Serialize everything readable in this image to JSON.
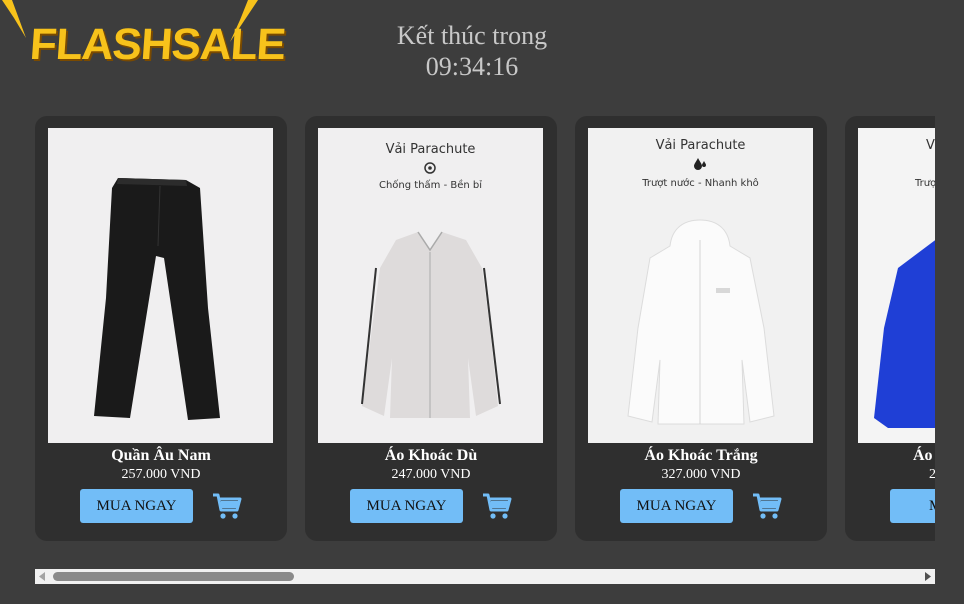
{
  "brand": {
    "logo_text": "FLASHSALE",
    "accent_color": "#f7c21b"
  },
  "countdown": {
    "label": "Kết thúc trong",
    "time": "09:34:16"
  },
  "products": [
    {
      "name": "Quần Âu Nam",
      "price": "257.000 VND",
      "button": "MUA NGAY",
      "cart_icon": "cart-icon"
    },
    {
      "name": "Áo Khoác Dù",
      "price": "247.000 VND",
      "button": "MUA NGAY",
      "cart_icon": "cart-icon",
      "image_caption": {
        "title": "Vải Parachute",
        "subtitle": "Chống thấm - Bền bỉ",
        "icon": "gear-icon"
      }
    },
    {
      "name": "Áo Khoác Trắng",
      "price": "327.000 VND",
      "button": "MUA NGAY",
      "cart_icon": "cart-icon",
      "image_caption": {
        "title": "Vải Parachute",
        "subtitle": "Trượt nước - Nhanh khô",
        "icon": "water-drop-icon"
      }
    },
    {
      "name": "Áo",
      "price": "2",
      "button": "MUA",
      "cart_icon": "cart-icon",
      "image_caption": {
        "title": "V",
        "subtitle": "Trượ"
      }
    }
  ],
  "colors": {
    "background": "#3d3d3d",
    "card": "#2f2f2f",
    "button": "#72bdf7",
    "cart": "#72bdf7"
  }
}
